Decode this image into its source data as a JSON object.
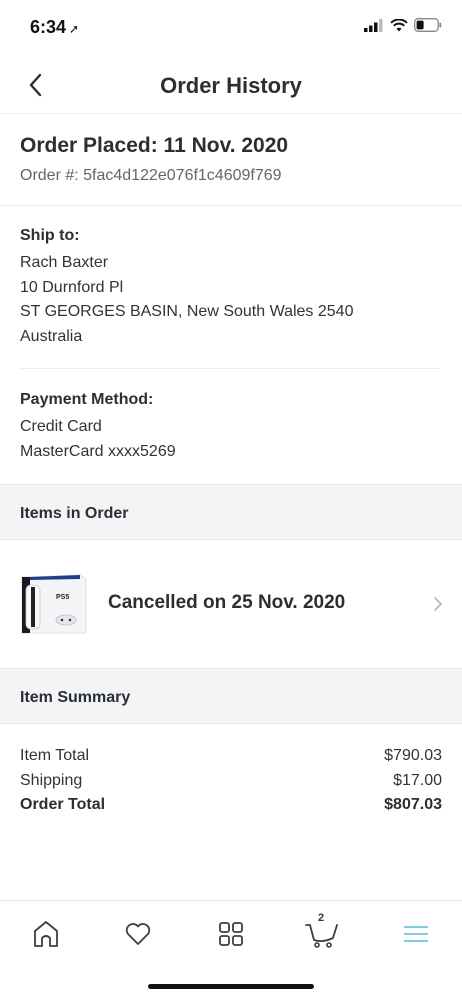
{
  "status_bar": {
    "time": "6:34",
    "location_arrow": "location-arrow-icon"
  },
  "nav": {
    "title": "Order History",
    "back_icon": "chevron-left-icon"
  },
  "order": {
    "placed": "Order Placed: 11 Nov. 2020",
    "number": "Order #: 5fac4d122e076f1c4609f769"
  },
  "shipping": {
    "label": "Ship to:",
    "name": "Rach Baxter",
    "street": "10 Durnford Pl",
    "city_line": "ST GEORGES BASIN, New South Wales 2540",
    "country": "Australia"
  },
  "payment": {
    "label": "Payment Method:",
    "type": "Credit Card",
    "card": "MasterCard xxxx5269"
  },
  "items_section": {
    "title": "Items in Order"
  },
  "item": {
    "status": "Cancelled on 25 Nov. 2020",
    "thumbnail_text": "PS5"
  },
  "summary_section": {
    "title": "Item Summary"
  },
  "summary": {
    "item_total_label": "Item Total",
    "item_total_value": "$790.03",
    "shipping_label": "Shipping",
    "shipping_value": "$17.00",
    "order_total_label": "Order Total",
    "order_total_value": "$807.03"
  },
  "tabs": {
    "items": [
      "home-icon",
      "heart-icon",
      "grid-icon",
      "cart-icon",
      "menu-icon"
    ],
    "cart_count": "2",
    "active_color": "#5bb7d5"
  }
}
